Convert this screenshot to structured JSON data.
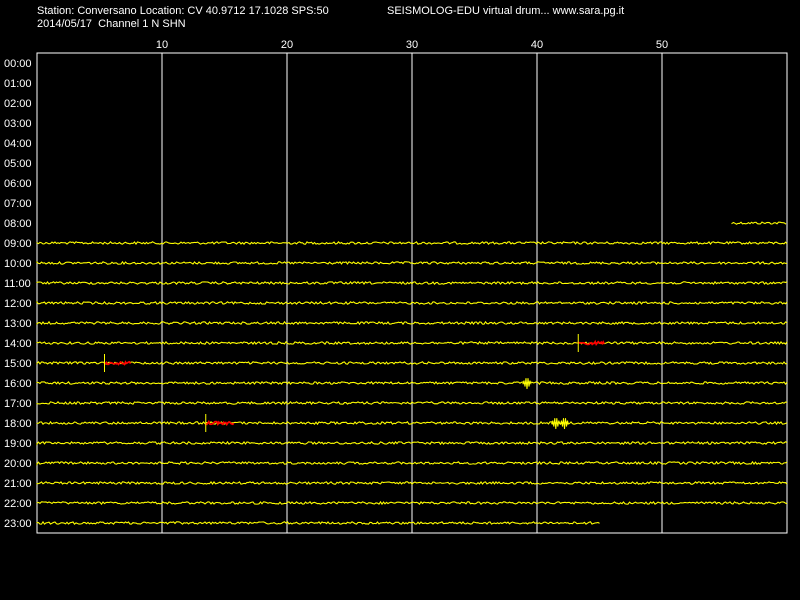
{
  "header": {
    "station_line": "Station: Conversano Location: CV 40.9712 17.1028 SPS:50",
    "date_channel": "2014/05/17  Channel 1 N SHN",
    "app_title": "SEISMOLOG-EDU virtual drum... www.sara.pg.it"
  },
  "colors": {
    "background": "#000000",
    "trace": "#ffff00",
    "event": "#ff0000",
    "grid": "#ffffff",
    "text": "#ffffff"
  },
  "chart_data": {
    "type": "line",
    "title": "",
    "xlabel": "",
    "ylabel": "",
    "xlim": [
      0,
      60
    ],
    "x_ticks": [
      10,
      20,
      30,
      40,
      50
    ],
    "grid": true,
    "rows": [
      "00:00",
      "01:00",
      "02:00",
      "03:00",
      "04:00",
      "05:00",
      "06:00",
      "07:00",
      "08:00",
      "09:00",
      "10:00",
      "11:00",
      "12:00",
      "13:00",
      "14:00",
      "15:00",
      "16:00",
      "17:00",
      "18:00",
      "19:00",
      "20:00",
      "21:00",
      "22:00",
      "23:00"
    ],
    "traces": [
      {
        "hour": "08:00",
        "start_min": 55.6,
        "end_min": 60
      },
      {
        "hour": "09:00",
        "start_min": 0,
        "end_min": 60
      },
      {
        "hour": "10:00",
        "start_min": 0,
        "end_min": 60
      },
      {
        "hour": "11:00",
        "start_min": 0,
        "end_min": 60
      },
      {
        "hour": "12:00",
        "start_min": 0,
        "end_min": 60
      },
      {
        "hour": "13:00",
        "start_min": 0,
        "end_min": 60
      },
      {
        "hour": "14:00",
        "start_min": 0,
        "end_min": 60
      },
      {
        "hour": "15:00",
        "start_min": 0,
        "end_min": 60
      },
      {
        "hour": "16:00",
        "start_min": 0,
        "end_min": 60
      },
      {
        "hour": "17:00",
        "start_min": 0,
        "end_min": 60
      },
      {
        "hour": "18:00",
        "start_min": 0,
        "end_min": 60
      },
      {
        "hour": "19:00",
        "start_min": 0,
        "end_min": 60
      },
      {
        "hour": "20:00",
        "start_min": 0,
        "end_min": 60
      },
      {
        "hour": "21:00",
        "start_min": 0,
        "end_min": 60
      },
      {
        "hour": "22:00",
        "start_min": 0,
        "end_min": 60
      },
      {
        "hour": "23:00",
        "start_min": 0,
        "end_min": 45
      }
    ],
    "events": [
      {
        "hour": "14:00",
        "start_min": 43.3,
        "end_min": 45.4
      },
      {
        "hour": "15:00",
        "start_min": 5.4,
        "end_min": 7.5
      },
      {
        "hour": "18:00",
        "start_min": 13.5,
        "end_min": 15.8
      }
    ],
    "spikes": [
      {
        "hour": "16:00",
        "min": 39.2
      },
      {
        "hour": "18:00",
        "min": 41.5
      },
      {
        "hour": "18:00",
        "min": 42.2
      }
    ]
  }
}
